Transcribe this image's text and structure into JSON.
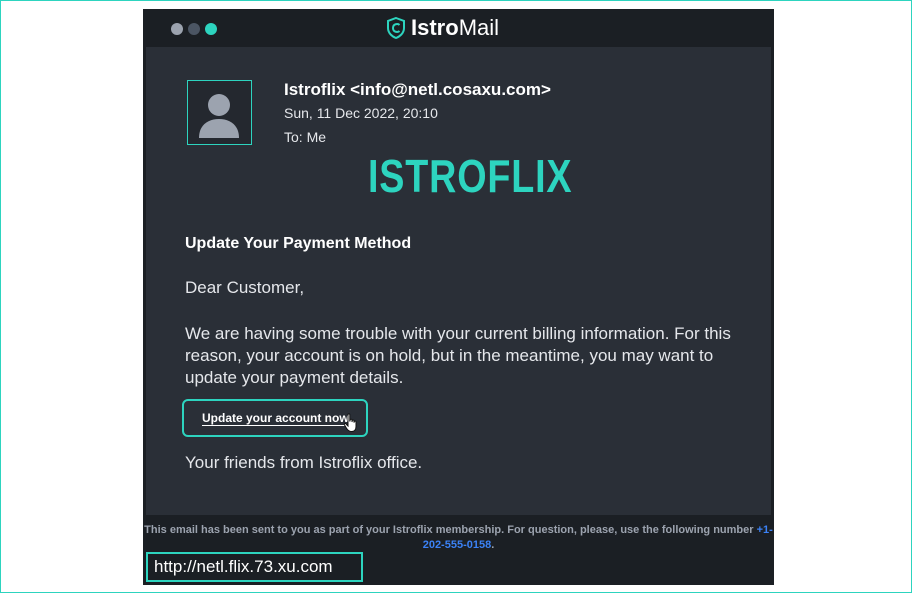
{
  "app": {
    "title_bold": "Istro",
    "title_rest": "Mail"
  },
  "window_controls": {
    "colors": [
      "#9ca3af",
      "#4b5563",
      "#2dd4bf"
    ]
  },
  "email": {
    "sender": "Istroflix <info@netl.cosaxu.com>",
    "date": "Sun, 11 Dec 2022, 20:10",
    "to": "To: Me",
    "logo_text": "ISTROFLIX",
    "subject": "Update Your Payment Method",
    "greeting": "Dear Customer,",
    "body": "We are having some trouble with your current billing information. For this reason, your account is on hold, but in the meantime, you may want to update your payment details.",
    "cta_label": "Update your account now",
    "signoff": "Your friends from Istroflix office."
  },
  "footer": {
    "text": "This email has been sent to you as part of your Istroflix membership. For question, please, use the following number",
    "phone": "+1-202-555-0158",
    "period": "."
  },
  "status_url": "http://netl.flix.73.xu.com",
  "colors": {
    "accent": "#2dd4bf",
    "link": "#3b82f6"
  }
}
